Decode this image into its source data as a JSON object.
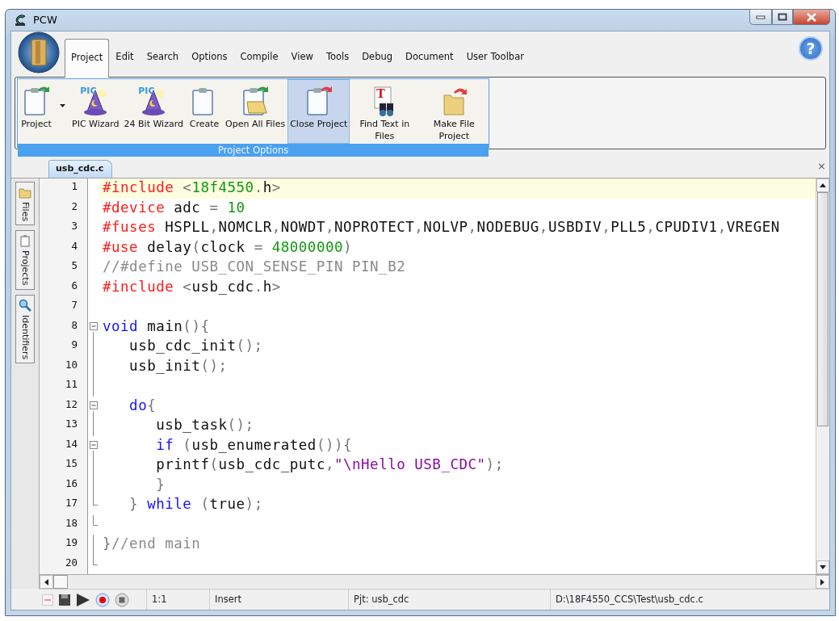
{
  "window": {
    "title": "PCW"
  },
  "ribbon_tabs": [
    {
      "label": "Project",
      "selected": true
    },
    {
      "label": "Edit",
      "selected": false
    },
    {
      "label": "Search",
      "selected": false
    },
    {
      "label": "Options",
      "selected": false
    },
    {
      "label": "Compile",
      "selected": false
    },
    {
      "label": "View",
      "selected": false
    },
    {
      "label": "Tools",
      "selected": false
    },
    {
      "label": "Debug",
      "selected": false
    },
    {
      "label": "Document",
      "selected": false
    },
    {
      "label": "User Toolbar",
      "selected": false
    }
  ],
  "help_button": {
    "label": "?"
  },
  "ribbon_group": {
    "title": "Project Options",
    "buttons": [
      {
        "kind": "clipboard-green",
        "label": "Project",
        "highlighted": false
      },
      {
        "kind": "caret",
        "highlighted": false
      },
      {
        "kind": "wizard",
        "label": "PIC Wizard",
        "icon_text": "PIC",
        "highlighted": false
      },
      {
        "kind": "wizard",
        "label": "24 Bit Wizard",
        "icon_text": "PIC",
        "highlighted": false
      },
      {
        "kind": "clipboard",
        "label": "Create",
        "highlighted": false
      },
      {
        "kind": "folder-open",
        "label": "Open All Files",
        "highlighted": false
      },
      {
        "kind": "clipboard-red",
        "label": "Close Project",
        "highlighted": true
      },
      {
        "kind": "find",
        "label": "Find Text in Files",
        "icon_text": "T",
        "highlighted": false
      },
      {
        "kind": "folder-red",
        "label": "Make File Project",
        "highlighted": false
      }
    ]
  },
  "doc_tabs": [
    {
      "label": "usb_cdc.c",
      "selected": true
    }
  ],
  "doc_close": {
    "label": "×"
  },
  "side_tabs": [
    {
      "kind": "folder",
      "label": "Files"
    },
    {
      "kind": "clipboard",
      "label": "Projects"
    },
    {
      "kind": "magnifier",
      "label": "Identifiers"
    }
  ],
  "editor": {
    "lines": [
      {
        "number": "1",
        "current": true,
        "kind": "plain",
        "tokens": [
          {
            "kind": "dir",
            "text": "#include"
          },
          {
            "kind": "op",
            "text": " <"
          },
          {
            "kind": "num",
            "text": "18f4550"
          },
          {
            "kind": "op",
            "text": "."
          },
          {
            "kind": "txt",
            "text": "h"
          },
          {
            "kind": "op",
            "text": ">"
          }
        ]
      },
      {
        "number": "2",
        "current": false,
        "kind": "plain",
        "tokens": [
          {
            "kind": "dir",
            "text": "#device"
          },
          {
            "kind": "txt",
            "text": " adc "
          },
          {
            "kind": "op",
            "text": "= "
          },
          {
            "kind": "num",
            "text": "10"
          }
        ]
      },
      {
        "number": "3",
        "current": false,
        "kind": "plain",
        "tokens": [
          {
            "kind": "dir",
            "text": "#fuses"
          },
          {
            "kind": "txt",
            "text": " HSPLL"
          },
          {
            "kind": "op",
            "text": ","
          },
          {
            "kind": "txt",
            "text": "NOMCLR"
          },
          {
            "kind": "op",
            "text": ","
          },
          {
            "kind": "txt",
            "text": "NOWDT"
          },
          {
            "kind": "op",
            "text": ","
          },
          {
            "kind": "txt",
            "text": "NOPROTECT"
          },
          {
            "kind": "op",
            "text": ","
          },
          {
            "kind": "txt",
            "text": "NOLVP"
          },
          {
            "kind": "op",
            "text": ","
          },
          {
            "kind": "txt",
            "text": "NODEBUG"
          },
          {
            "kind": "op",
            "text": ","
          },
          {
            "kind": "txt",
            "text": "USBDIV"
          },
          {
            "kind": "op",
            "text": ","
          },
          {
            "kind": "txt",
            "text": "PLL5"
          },
          {
            "kind": "op",
            "text": ","
          },
          {
            "kind": "txt",
            "text": "CPUDIV1"
          },
          {
            "kind": "op",
            "text": ","
          },
          {
            "kind": "txt",
            "text": "VREGEN"
          }
        ]
      },
      {
        "number": "4",
        "current": false,
        "kind": "plain",
        "tokens": [
          {
            "kind": "dir",
            "text": "#use"
          },
          {
            "kind": "txt",
            "text": " delay"
          },
          {
            "kind": "op",
            "text": "("
          },
          {
            "kind": "txt",
            "text": "clock "
          },
          {
            "kind": "op",
            "text": "= "
          },
          {
            "kind": "num",
            "text": "48000000"
          },
          {
            "kind": "op",
            "text": ")"
          }
        ]
      },
      {
        "number": "5",
        "current": false,
        "kind": "plain",
        "tokens": [
          {
            "kind": "cmt",
            "text": "//#define USB_CON_SENSE_PIN PIN_B2"
          }
        ]
      },
      {
        "number": "6",
        "current": false,
        "kind": "plain",
        "tokens": [
          {
            "kind": "dir",
            "text": "#include"
          },
          {
            "kind": "op",
            "text": " <"
          },
          {
            "kind": "txt",
            "text": "usb_cdc"
          },
          {
            "kind": "op",
            "text": "."
          },
          {
            "kind": "txt",
            "text": "h"
          },
          {
            "kind": "op",
            "text": ">"
          }
        ]
      },
      {
        "number": "7",
        "current": false,
        "kind": "plain"
      },
      {
        "number": "8",
        "current": false,
        "kind": "fold-start",
        "tokens": [
          {
            "kind": "kw",
            "text": "void"
          },
          {
            "kind": "txt",
            "text": " main"
          },
          {
            "kind": "op",
            "text": "(){"
          }
        ]
      },
      {
        "number": "9",
        "current": false,
        "kind": "fold-body",
        "tokens": [
          {
            "kind": "txt",
            "text": "   usb_cdc_init"
          },
          {
            "kind": "op",
            "text": "();"
          }
        ]
      },
      {
        "number": "10",
        "current": false,
        "kind": "fold-body",
        "tokens": [
          {
            "kind": "txt",
            "text": "   usb_init"
          },
          {
            "kind": "op",
            "text": "();"
          }
        ]
      },
      {
        "number": "11",
        "current": false,
        "kind": "fold-body"
      },
      {
        "number": "12",
        "current": false,
        "kind": "fold-start",
        "tokens": [
          {
            "kind": "kw",
            "text": "   do"
          },
          {
            "kind": "op",
            "text": "{"
          }
        ]
      },
      {
        "number": "13",
        "current": false,
        "kind": "fold-body",
        "tokens": [
          {
            "kind": "txt",
            "text": "      usb_task"
          },
          {
            "kind": "op",
            "text": "();"
          }
        ]
      },
      {
        "number": "14",
        "current": false,
        "kind": "fold-start",
        "tokens": [
          {
            "kind": "kw",
            "text": "      if"
          },
          {
            "kind": "op",
            "text": " ("
          },
          {
            "kind": "txt",
            "text": "usb_enumerated"
          },
          {
            "kind": "op",
            "text": "()){"
          }
        ]
      },
      {
        "number": "15",
        "current": false,
        "kind": "fold-body",
        "tokens": [
          {
            "kind": "txt",
            "text": "      printf"
          },
          {
            "kind": "op",
            "text": "("
          },
          {
            "kind": "txt",
            "text": "usb_cdc_putc"
          },
          {
            "kind": "op",
            "text": ","
          },
          {
            "kind": "str",
            "text": "\"\\nHello USB_CDC\""
          },
          {
            "kind": "op",
            "text": ");"
          }
        ]
      },
      {
        "number": "16",
        "current": false,
        "kind": "fold-body",
        "tokens": [
          {
            "kind": "op",
            "text": "      }"
          }
        ]
      },
      {
        "number": "17",
        "current": false,
        "kind": "fold-end",
        "tokens": [
          {
            "kind": "op",
            "text": "   } "
          },
          {
            "kind": "kw",
            "text": "while"
          },
          {
            "kind": "op",
            "text": " ("
          },
          {
            "kind": "txt",
            "text": "true"
          },
          {
            "kind": "op",
            "text": ");"
          }
        ]
      },
      {
        "number": "18",
        "current": false,
        "kind": "fold-end"
      },
      {
        "number": "19",
        "current": false,
        "kind": "fold-body",
        "tokens": [
          {
            "kind": "op",
            "text": "}"
          },
          {
            "kind": "cmt",
            "text": "//end main"
          }
        ]
      },
      {
        "number": "20",
        "current": false,
        "kind": "fold-end"
      }
    ]
  },
  "status_bar": {
    "position": "1:1",
    "mode": "Insert",
    "project": "Pjt: usb_cdc",
    "path": "D:\\18F4550_CCS\\Test\\usb_cdc.c"
  }
}
